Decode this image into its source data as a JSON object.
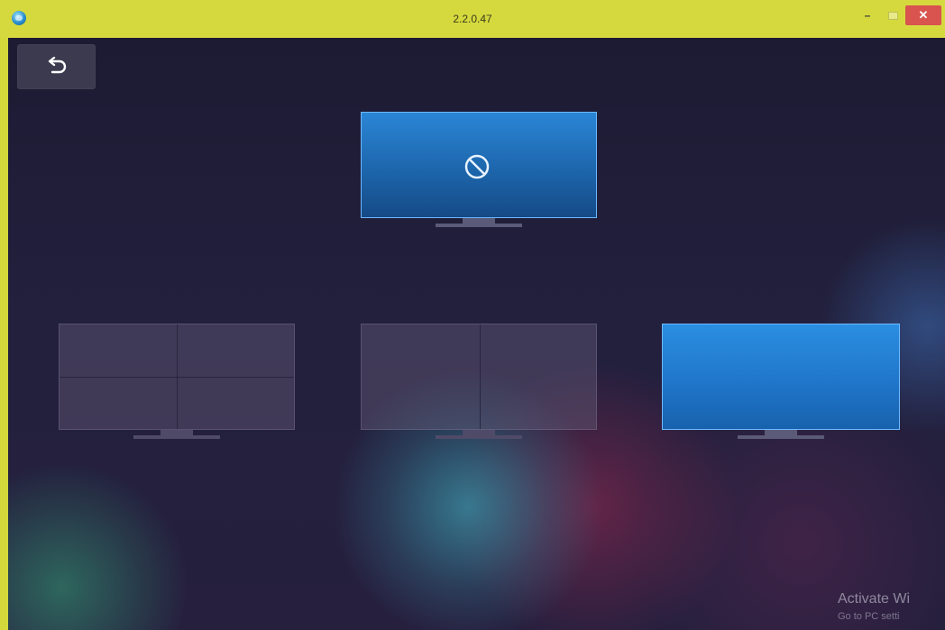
{
  "window": {
    "title": "2.2.0.47",
    "controls": {
      "minimize": "–",
      "maximize": "",
      "close": "✕"
    }
  },
  "toolbar": {
    "back_icon": "undo-arrow-icon"
  },
  "layouts": {
    "single_top": {
      "state": "selected",
      "icon": "no-entry-icon"
    },
    "quad": {
      "state": "inactive",
      "panes": 4
    },
    "dual": {
      "state": "inactive",
      "panes": 2
    },
    "single": {
      "state": "active",
      "panes": 1
    }
  },
  "watermark": {
    "line1": "Activate Wi",
    "line2": "Go to PC setti"
  },
  "colors": {
    "titlebar": "#d5d93e",
    "accent_blue": "#2a86d6",
    "close_red": "#d9534f",
    "background": "#1d1b33"
  }
}
